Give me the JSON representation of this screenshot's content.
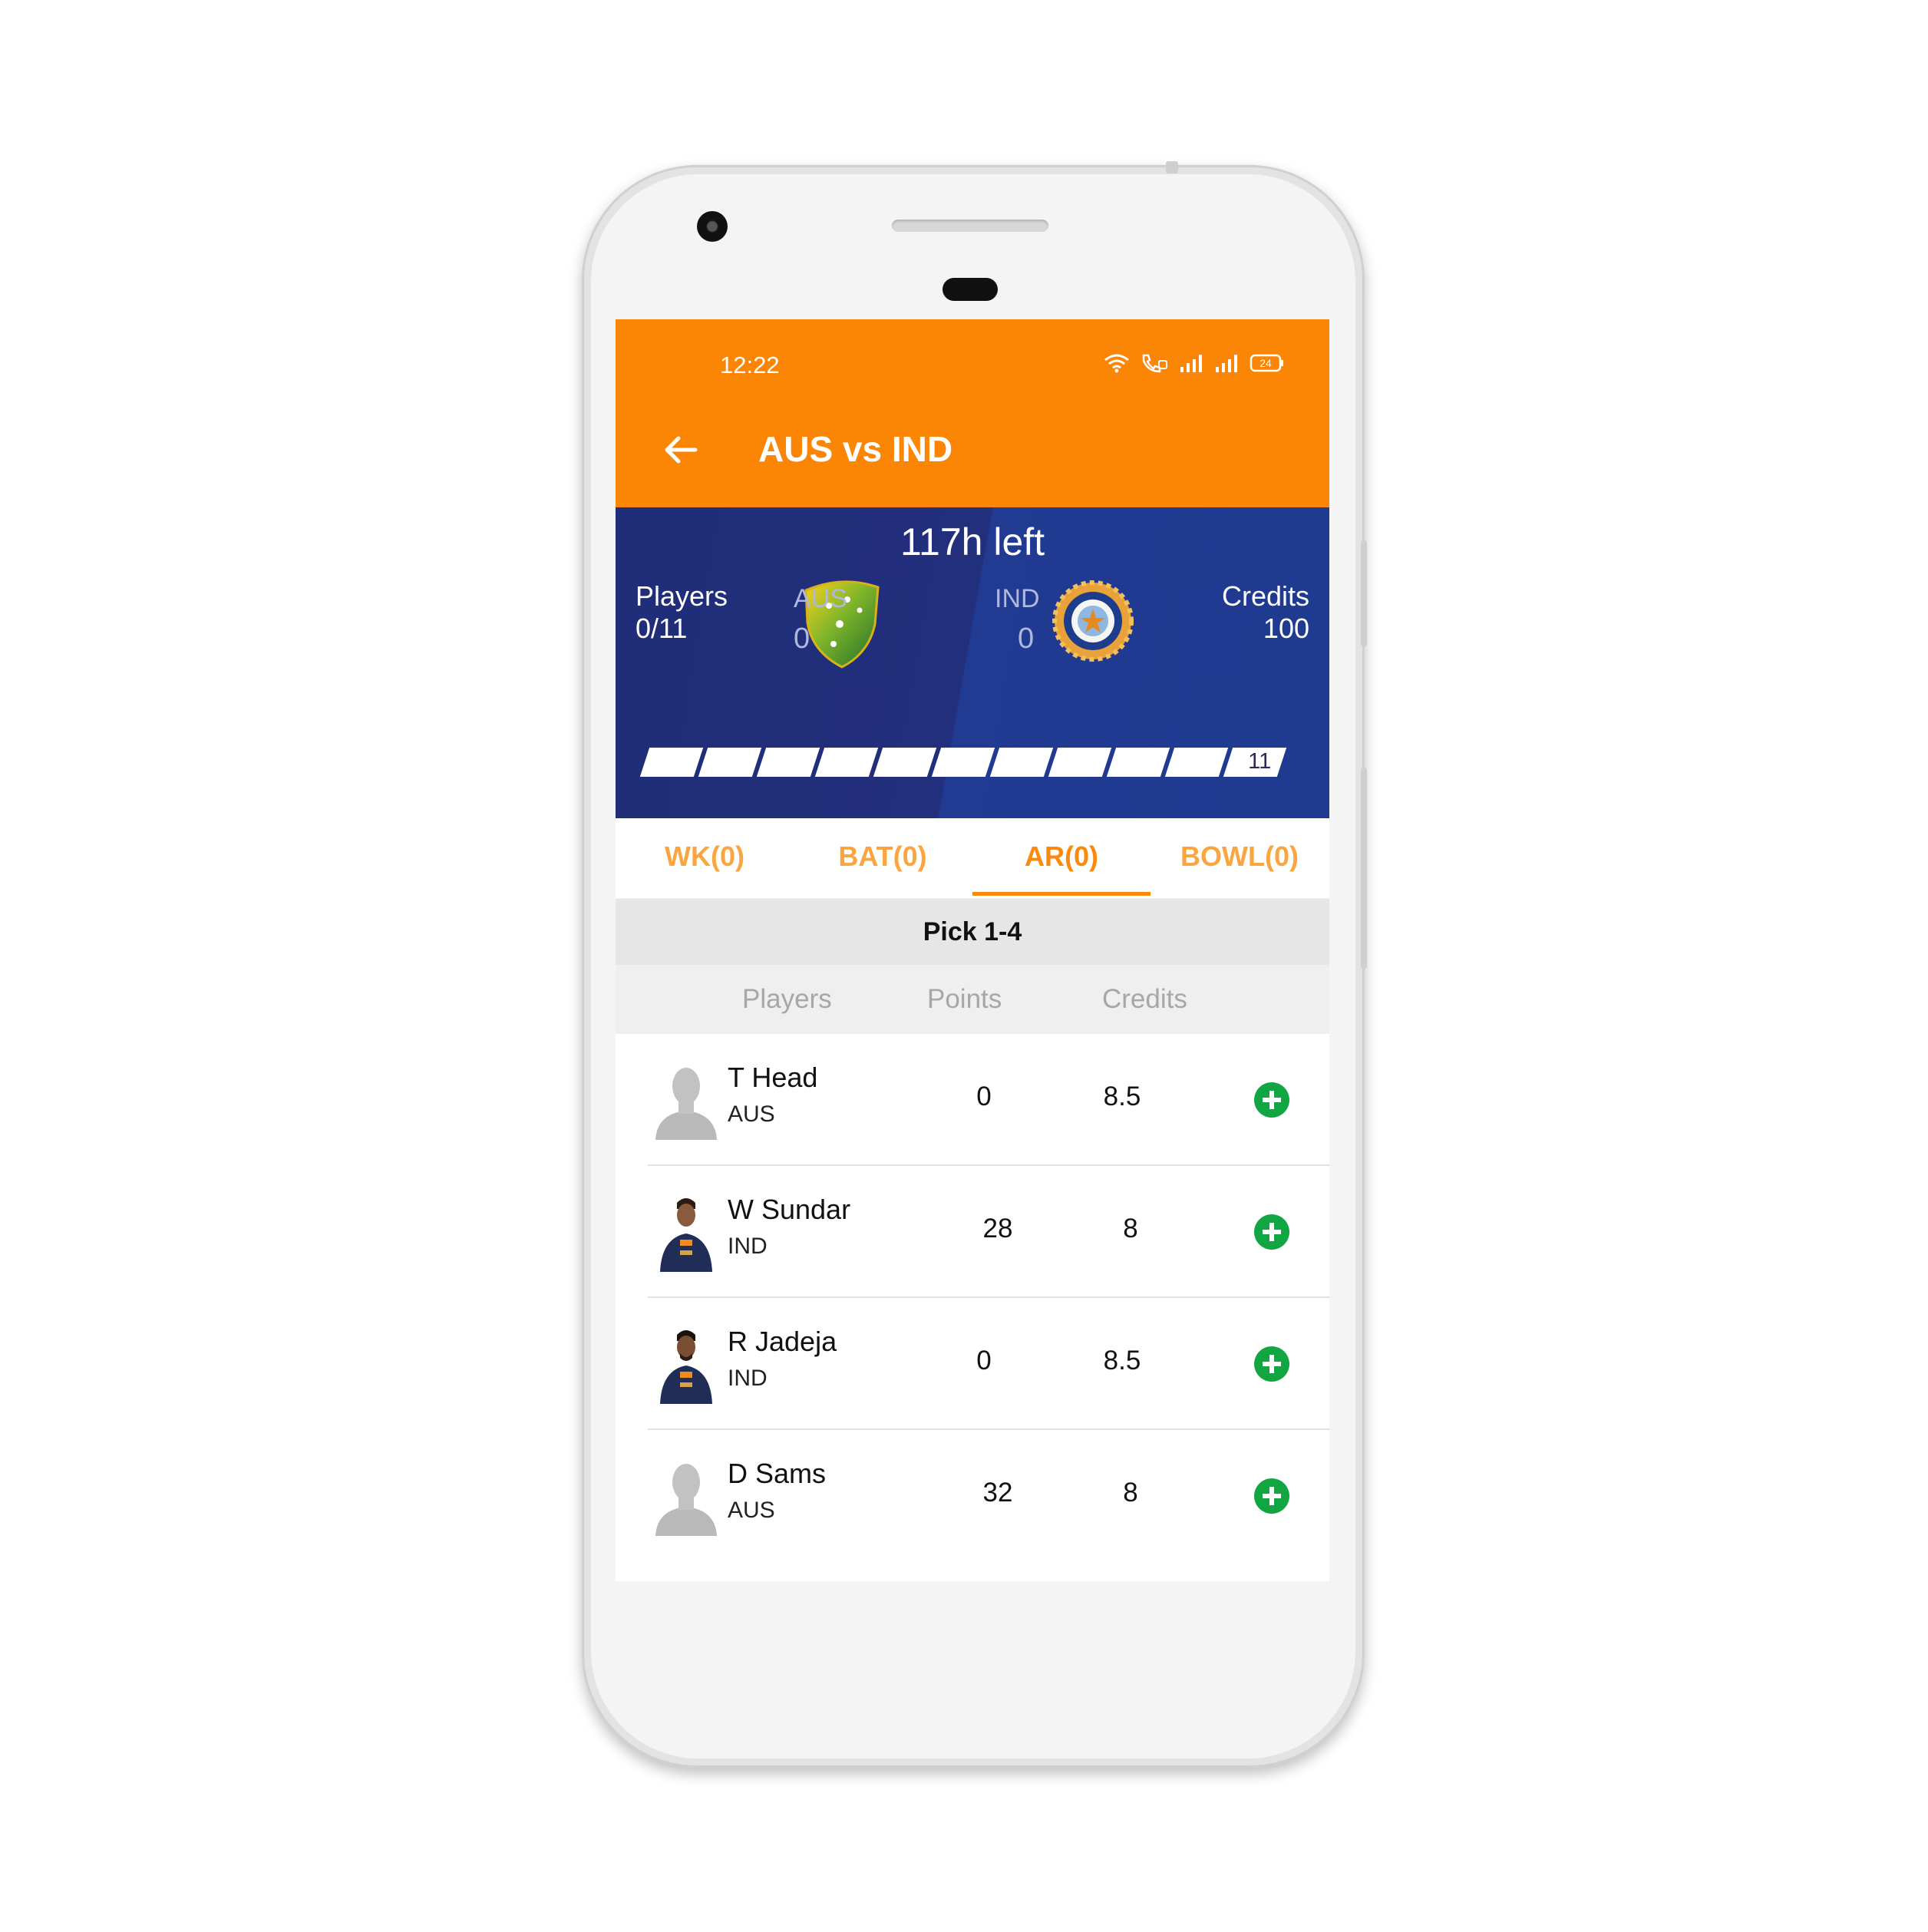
{
  "status_bar": {
    "time": "12:22",
    "battery": "24"
  },
  "header": {
    "title": "AUS vs IND"
  },
  "match": {
    "time_left": "117h left",
    "players_label": "Players",
    "players_value": "0/11",
    "credits_label": "Credits",
    "credits_value": "100",
    "team1": {
      "code": "AUS",
      "score": "0"
    },
    "team2": {
      "code": "IND",
      "score": "0"
    },
    "progress_total": "11",
    "progress_filled": 0
  },
  "tabs": [
    {
      "label": "WK(0)"
    },
    {
      "label": "BAT(0)"
    },
    {
      "label": "AR(0)"
    },
    {
      "label": "BOWL(0)"
    }
  ],
  "active_tab": "AR(0)",
  "pick_hint": "Pick 1-4",
  "columns": {
    "players": "Players",
    "points": "Points",
    "credits": "Credits"
  },
  "players": [
    {
      "name": "T Head",
      "team": "AUS",
      "points": "0",
      "credits": "8.5",
      "avatar": "placeholder-avatar"
    },
    {
      "name": "W Sundar",
      "team": "IND",
      "points": "28",
      "credits": "8",
      "avatar": "player-photo"
    },
    {
      "name": "R Jadeja",
      "team": "IND",
      "points": "0",
      "credits": "8.5",
      "avatar": "player-photo"
    },
    {
      "name": "D Sams",
      "team": "AUS",
      "points": "32",
      "credits": "8",
      "avatar": "placeholder-avatar"
    }
  ],
  "colors": {
    "primary": "#fb8505",
    "hero": "#202d78",
    "add": "#11a641",
    "tab_text": "#fba541"
  }
}
